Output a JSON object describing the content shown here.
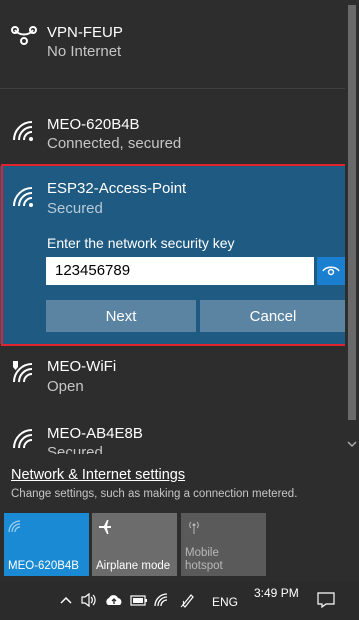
{
  "networks": [
    {
      "name": "VPN-FEUP",
      "status": "No Internet",
      "icon": "vpn-icon"
    },
    {
      "name": "MEO-620B4B",
      "status": "Connected, secured",
      "icon": "wifi-icon"
    },
    {
      "name": "ESP32-Access-Point",
      "status": "Secured",
      "icon": "wifi-icon"
    },
    {
      "name": "MEO-WiFi",
      "status": "Open",
      "icon": "wifi-open-icon"
    },
    {
      "name": "MEO-AB4E8B",
      "status": "Secured",
      "icon": "wifi-icon"
    }
  ],
  "connect": {
    "prompt": "Enter the network security key",
    "password": "123456789",
    "next_label": "Next",
    "cancel_label": "Cancel"
  },
  "settings": {
    "link": "Network & Internet settings",
    "desc": "Change settings, such as making a connection metered."
  },
  "tiles": [
    {
      "label": "MEO-620B4B",
      "icon": "wifi-icon",
      "active": true
    },
    {
      "label": "Airplane mode",
      "icon": "airplane-icon",
      "active": false
    },
    {
      "label1": "Mobile",
      "label2": "hotspot",
      "icon": "hotspot-icon",
      "active": false
    }
  ],
  "taskbar": {
    "time": "3:49 PM",
    "lang": "ENG"
  },
  "colors": {
    "selected_bg": "#1e5a82",
    "highlight_border": "#e0242f",
    "accent": "#1a7fcf",
    "button": "#5a84a2"
  }
}
